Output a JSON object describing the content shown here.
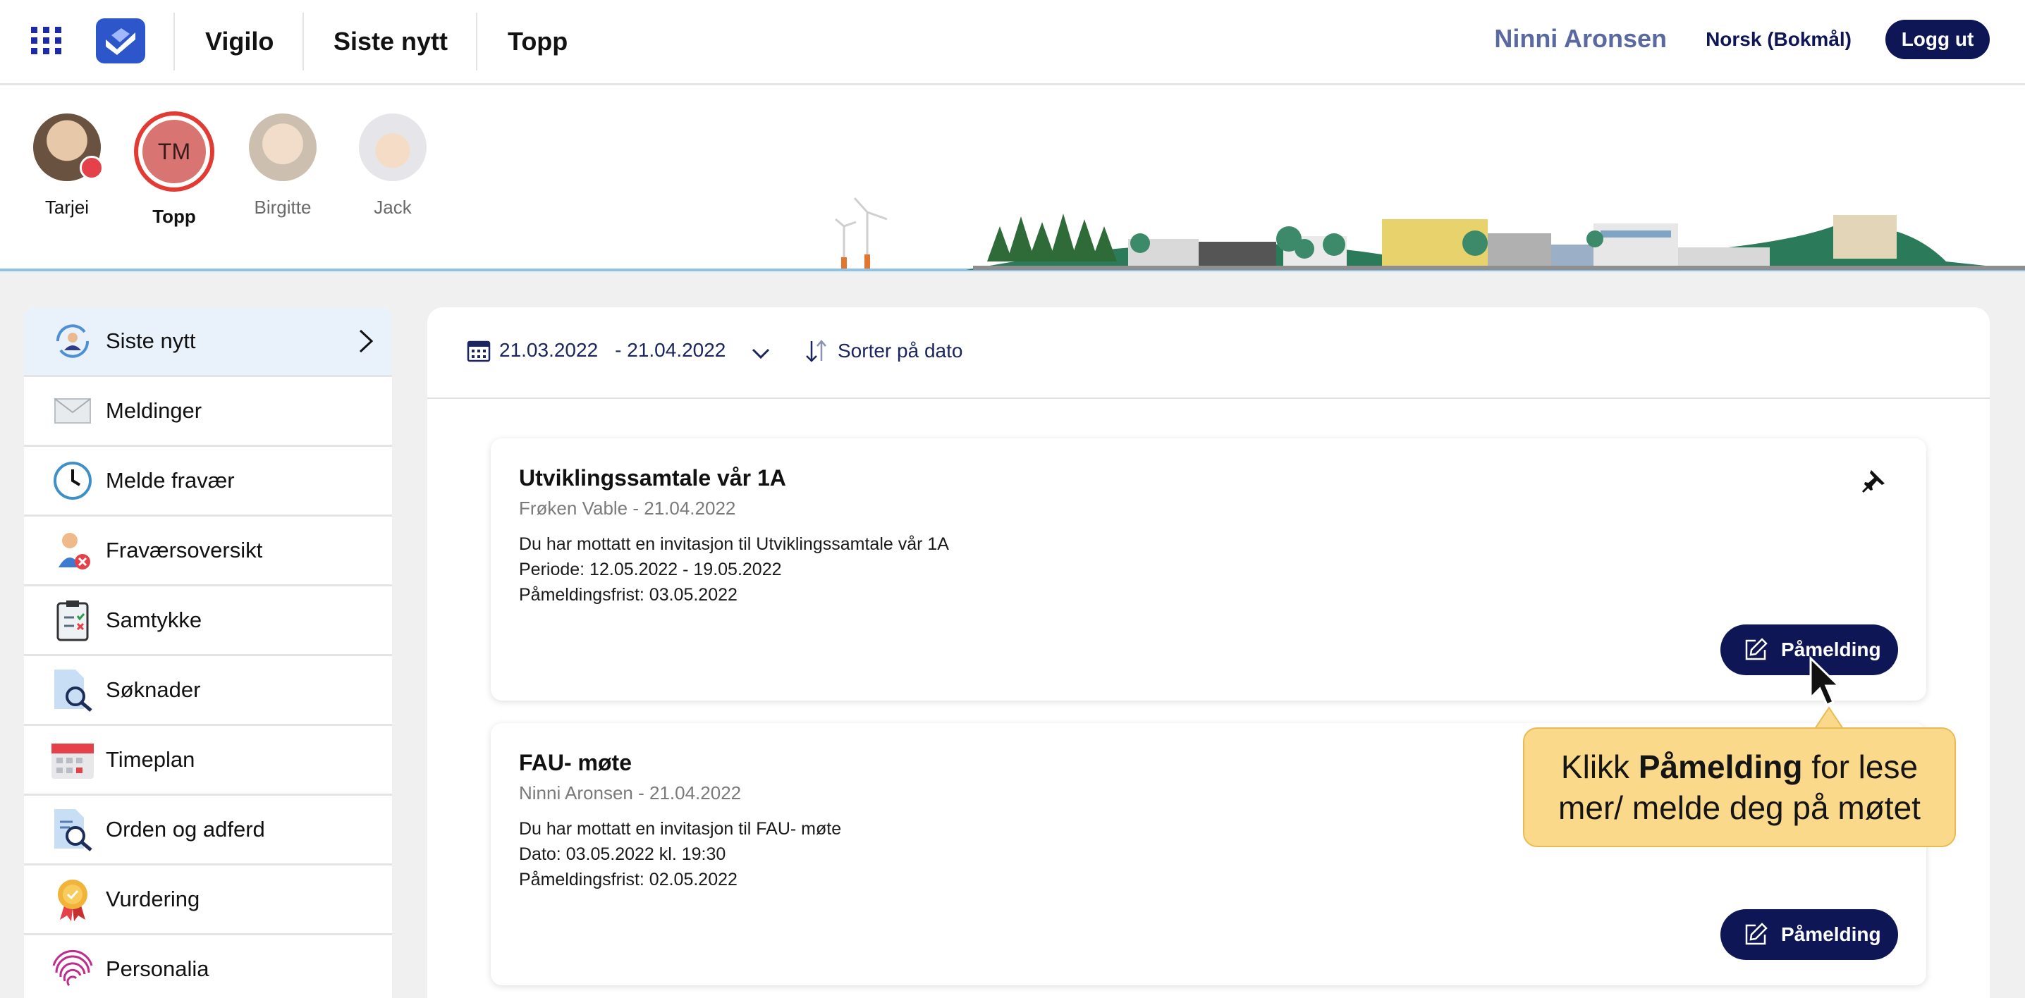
{
  "header": {
    "brand": "Vigilo",
    "nav": [
      "Siste nytt",
      "Topp"
    ],
    "user_name": "Ninni Aronsen",
    "language": "Norsk (Bokmål)",
    "logout_label": "Logg ut"
  },
  "children": [
    {
      "name": "Tarjei",
      "has_alert": true
    },
    {
      "name": "Topp",
      "initials": "TM",
      "selected": true
    },
    {
      "name": "Birgitte"
    },
    {
      "name": "Jack"
    }
  ],
  "sidebar": {
    "items": [
      {
        "label": "Siste nytt",
        "icon": "news-refresh-icon",
        "active": true
      },
      {
        "label": "Meldinger",
        "icon": "envelope-icon"
      },
      {
        "label": "Melde fravær",
        "icon": "clock-icon"
      },
      {
        "label": "Fraværsoversikt",
        "icon": "person-absence-icon"
      },
      {
        "label": "Samtykke",
        "icon": "clipboard-check-icon"
      },
      {
        "label": "Søknader",
        "icon": "document-search-icon"
      },
      {
        "label": "Timeplan",
        "icon": "calendar-icon"
      },
      {
        "label": "Orden og adferd",
        "icon": "document-magnify-icon"
      },
      {
        "label": "Vurdering",
        "icon": "award-medal-icon"
      },
      {
        "label": "Personalia",
        "icon": "fingerprint-icon"
      }
    ]
  },
  "filter": {
    "date_from": "21.03.2022",
    "date_to": "- 21.04.2022",
    "sort_label": "Sorter på dato"
  },
  "posts": [
    {
      "title": "Utviklingssamtale vår 1A",
      "meta": "Frøken Vable - 21.04.2022",
      "lines": [
        "Du har mottatt en invitasjon til Utviklingssamtale vår 1A",
        "Periode: 12.05.2022 - 19.05.2022",
        "Påmeldingsfrist: 03.05.2022"
      ],
      "action": "Påmelding",
      "pinned": true
    },
    {
      "title": "FAU- møte",
      "meta": "Ninni Aronsen - 21.04.2022",
      "lines": [
        "Du har mottatt en invitasjon til FAU- møte",
        "Dato: 03.05.2022 kl. 19:30",
        "Påmeldingsfrist: 02.05.2022"
      ],
      "action": "Påmelding"
    }
  ],
  "tooltip": {
    "before": "Klikk ",
    "bold": "Påmelding",
    "after": " for lese mer/ melde deg på møtet"
  },
  "colors": {
    "primary": "#0e1656",
    "tooltip_bg": "#fbd98a",
    "active_item_bg": "#e9f2fb",
    "alert": "#e5414a"
  }
}
